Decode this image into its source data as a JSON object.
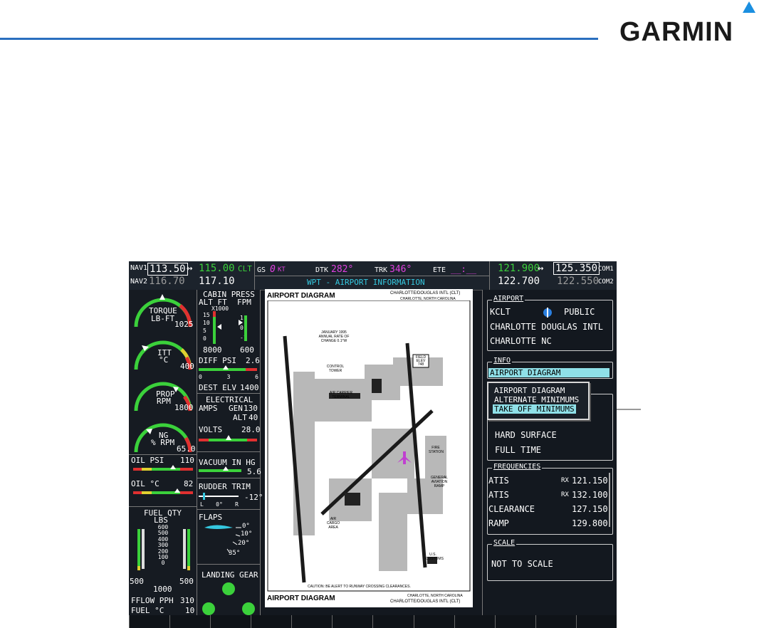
{
  "brand": {
    "name": "GARMIN",
    "rule_color": "#2a6fbf",
    "triangle_color": "#1b8fe0"
  },
  "topbar": {
    "nav1_label": "NAV1",
    "nav1_active": "113.50",
    "nav1_swap": "↔",
    "nav1_standby": "115.00",
    "nav1_id": "CLT",
    "nav2_label": "NAV2",
    "nav2_active": "116.70",
    "nav2_standby": "117.10",
    "gs_label": "GS",
    "gs_value": "0",
    "gs_unit": "KT",
    "dtk_label": "DTK",
    "dtk_value": "282°",
    "trk_label": "TRK",
    "trk_value": "346°",
    "ete_label": "ETE",
    "ete_value": "__:__",
    "page_title": "WPT - AIRPORT INFORMATION",
    "com1_active": "121.900",
    "com1_swap": "↔",
    "com1_standby": "125.350",
    "com1_label": "COM1",
    "com2_active": "122.700",
    "com2_standby": "122.550",
    "com2_label": "COM2"
  },
  "eis": {
    "torque_label": "TORQUE",
    "torque_unit": "LB-FT",
    "torque_value": "1025",
    "itt_label": "ITT",
    "itt_unit": "°C",
    "itt_value": "400",
    "prop_label": "PROP",
    "prop_unit": "RPM",
    "prop_value": "1800",
    "ng_label": "NG",
    "ng_unit": "% RPM",
    "ng_value": "65.0",
    "oil_psi_label": "OIL PSI",
    "oil_psi_value": "110",
    "oil_c_label": "OIL °C",
    "oil_c_value": "82",
    "fuel_qty_title": "FUEL QTY",
    "fuel_qty_unit": "LBS",
    "fuel_scale": [
      "600",
      "500",
      "400",
      "300",
      "200",
      "100",
      "0"
    ],
    "fuel_left": "500",
    "fuel_right": "500",
    "fuel_total": "1000",
    "fflow_label": "FFLOW PPH",
    "fflow_value": "310",
    "fuel_c_label": "FUEL °C",
    "fuel_c_value": "10"
  },
  "eis2": {
    "cabin_title": "CABIN PRESS",
    "alt_ft": "ALT FT",
    "fpm": "FPM",
    "x1000": "X1000",
    "alt_scale": [
      "15",
      "10",
      "5",
      "0"
    ],
    "fpm_scale": [
      "1",
      "0",
      "-1"
    ],
    "cabin_alt_value": "8000",
    "cabin_fpm_value": "600",
    "diff_psi_label": "DIFF PSI",
    "diff_psi_value": "2.6",
    "diff_scale": [
      "0",
      "3",
      "6"
    ],
    "dest_elv_label": "DEST ELV",
    "dest_elv_value": "1400",
    "electrical_title": "ELECTRICAL",
    "amps_label": "AMPS",
    "gen_label": "GEN",
    "gen_value": "130",
    "alt_label": "ALT",
    "alt_value": "40",
    "volts_label": "VOLTS",
    "volts_value": "28.0",
    "vacuum_label": "VACUUM IN HG",
    "vacuum_value": "5.6",
    "rudder_label": "RUDDER TRIM",
    "rudder_value": "-12°",
    "rudder_scale": [
      "L",
      "0°",
      "R"
    ],
    "flaps_label": "FLAPS",
    "flaps_scale": [
      "0°",
      "10°",
      "20°",
      "35°"
    ],
    "gear_label": "LANDING GEAR"
  },
  "chart": {
    "title_top": "AIRPORT DIAGRAM",
    "city_top": "CHARLOTTE/DOUGLAS INTL (CLT)",
    "sub_top": "CHARLOTTE, NORTH CAROLINA",
    "title_bottom": "AIRPORT DIAGRAM",
    "city_bottom": "CHARLOTTE/DOUGLAS INTL (CLT)",
    "sub_bottom": "CHARLOTTE, NORTH CAROLINA",
    "caution": "CAUTION: BE ALERT TO RUNWAY CROSSING CLEARANCES.",
    "field_elev": "FIELD ELEV 748",
    "labels": [
      "CONTROL TOWER",
      "AIR CARRIER TERMINAL",
      "FIRE STATION",
      "GENERAL AVIATION RAMP",
      "U.S. CUSTOMS",
      "AIR CARGO AREA",
      "JANUARY 1995 ANNUAL RATE OF CHANGE 0.1°W"
    ]
  },
  "rpanel": {
    "airport_title": "AIRPORT",
    "airport_id": "KCLT",
    "airport_type": "PUBLIC",
    "airport_name": "CHARLOTTE DOUGLAS INTL",
    "airport_city": "CHARLOTTE NC",
    "info_title": "INFO",
    "info_selected": "AIRPORT DIAGRAM",
    "menu": [
      "AIRPORT DIAGRAM",
      "ALTERNATE MINIMUMS",
      "TAKE OFF MINIMUMS"
    ],
    "info_lines": [
      "HARD SURFACE",
      "FULL TIME"
    ],
    "freq_title": "FREQUENCIES",
    "frequencies": [
      {
        "name": "ATIS",
        "rx": "RX",
        "freq": "121.150"
      },
      {
        "name": "ATIS",
        "rx": "RX",
        "freq": "132.100"
      },
      {
        "name": "CLEARANCE",
        "rx": "",
        "freq": "127.150"
      },
      {
        "name": "RAMP",
        "rx": "",
        "freq": "129.800"
      }
    ],
    "scale_title": "SCALE",
    "scale_value": "NOT TO SCALE"
  }
}
